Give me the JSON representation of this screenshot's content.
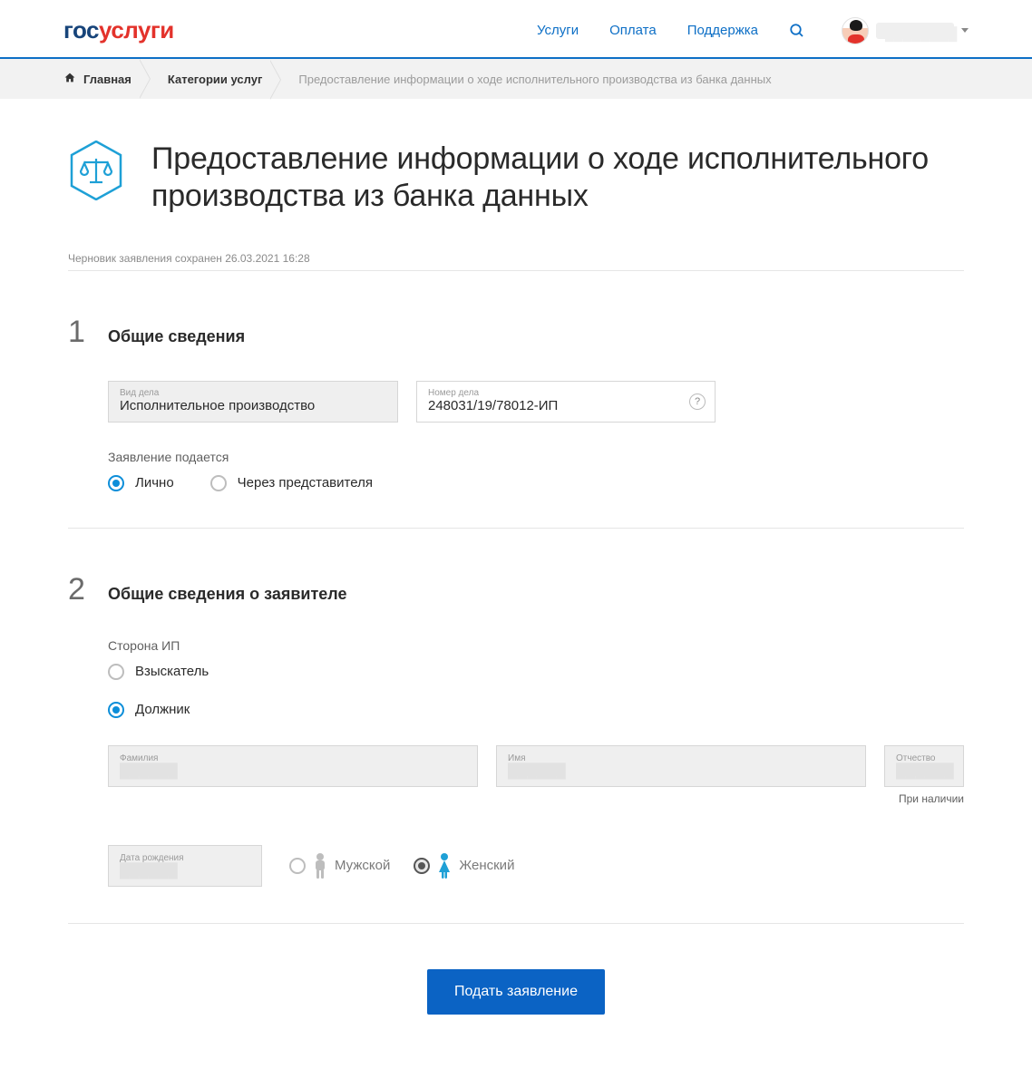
{
  "header": {
    "logo_part1": "гос",
    "logo_part2": "услуги",
    "nav": {
      "services": "Услуги",
      "payment": "Оплата",
      "support": "Поддержка"
    },
    "username": "████████"
  },
  "breadcrumb": {
    "home": "Главная",
    "categories": "Категории услуг",
    "current": "Предоставление информации о ходе исполнительного производства из банка данных"
  },
  "page_title": "Предоставление информации о ходе исполнительного производства из банка данных",
  "draft_note": "Черновик заявления сохранен 26.03.2021 16:28",
  "section1": {
    "num": "1",
    "title": "Общие сведения",
    "case_type_label": "Вид дела",
    "case_type_value": "Исполнительное производство",
    "case_num_label": "Номер дела",
    "case_num_value": "248031/19/78012-ИП",
    "filed_by_label": "Заявление подается",
    "radio_person": "Лично",
    "radio_rep": "Через представителя"
  },
  "section2": {
    "num": "2",
    "title": "Общие сведения о заявителе",
    "side_label": "Сторона ИП",
    "radio_creditor": "Взыскатель",
    "radio_debtor": "Должник",
    "surname_label": "Фамилия",
    "name_label": "Имя",
    "patronymic_label": "Отчество",
    "patronymic_hint": "При наличии",
    "dob_label": "Дата рождения",
    "gender_male": "Мужской",
    "gender_female": "Женский",
    "redacted": "██████"
  },
  "submit_label": "Подать заявление"
}
